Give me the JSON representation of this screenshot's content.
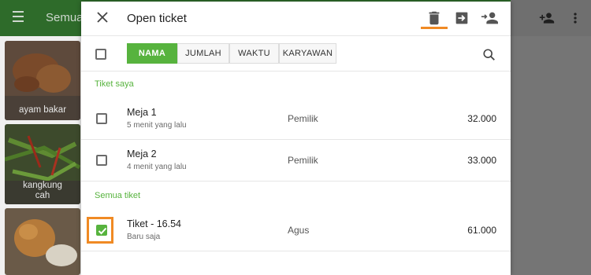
{
  "background": {
    "title": "Semua",
    "tiles": [
      {
        "label": "ayam bakar"
      },
      {
        "label": "kangkung\ncah"
      },
      {
        "label": ""
      }
    ]
  },
  "dialog": {
    "title": "Open ticket",
    "header_icons": [
      "delete-icon",
      "move-ticket-icon",
      "assign-user-icon"
    ],
    "tabs": [
      {
        "label": "NAMA",
        "active": true
      },
      {
        "label": "JUMLAH",
        "active": false
      },
      {
        "label": "WAKTU",
        "active": false
      },
      {
        "label": "KARYAWAN",
        "active": false
      }
    ],
    "sections": [
      {
        "title": "Tiket saya",
        "rows": [
          {
            "name": "Meja 1",
            "time": "5 menit yang lalu",
            "employee": "Pemilik",
            "amount": "32.000",
            "checked": false
          },
          {
            "name": "Meja 2",
            "time": "4 menit yang lalu",
            "employee": "Pemilik",
            "amount": "33.000",
            "checked": false
          }
        ]
      },
      {
        "title": "Semua tiket",
        "rows": [
          {
            "name": "Tiket - 16.54",
            "time": "Baru saja",
            "employee": "Agus",
            "amount": "61.000",
            "checked": true
          }
        ]
      }
    ]
  },
  "colors": {
    "accent_green": "#57b33e",
    "highlight_orange": "#f08a24",
    "appbar_green": "#2e6b2a"
  }
}
